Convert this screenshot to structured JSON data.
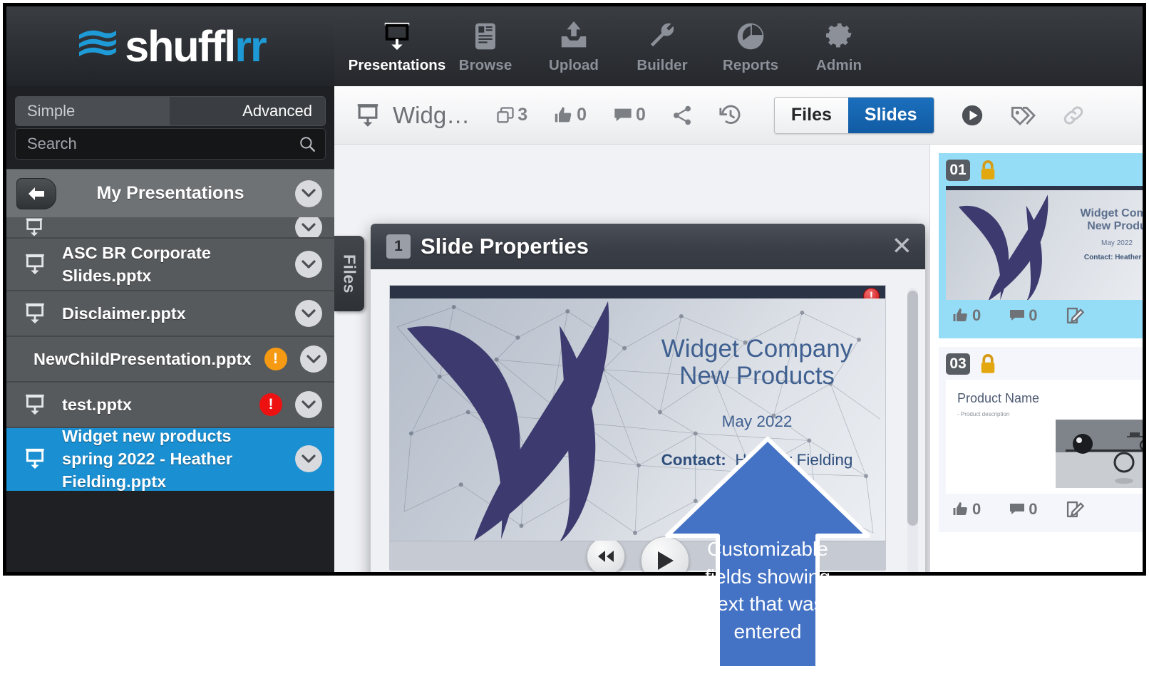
{
  "brand": {
    "name_white": "shuffl",
    "name_blue": "rr",
    "accent_blue": "#1e9ad6",
    "logo_icon": "stacked-slides-icon"
  },
  "topnav": {
    "items": [
      {
        "label": "Presentations",
        "icon": "presentation-screen-icon",
        "active": true
      },
      {
        "label": "Browse",
        "icon": "document-list-icon",
        "active": false
      },
      {
        "label": "Upload",
        "icon": "upload-tray-icon",
        "active": false
      },
      {
        "label": "Builder",
        "icon": "wrench-icon",
        "active": false
      },
      {
        "label": "Reports",
        "icon": "pie-chart-icon",
        "active": false
      },
      {
        "label": "Admin",
        "icon": "gear-icon",
        "active": false
      }
    ]
  },
  "sidebar": {
    "mode_simple": "Simple",
    "mode_advanced": "Advanced",
    "active_mode": "Advanced",
    "search_placeholder": "Search",
    "search_value": "",
    "search_icon": "magnifier-icon",
    "tree_header": "My Presentations",
    "back_icon": "back-arrow-icon",
    "chevron_icon": "chevron-down-icon",
    "items": [
      {
        "label": "ASC BR Corporate Slides.pptx",
        "icon": "presentation-screen-icon",
        "badge": null,
        "selected": false
      },
      {
        "label": "Disclaimer.pptx",
        "icon": "presentation-screen-icon",
        "badge": null,
        "selected": false
      },
      {
        "label": "NewChildPresentation.pptx",
        "icon": "presentation-screen-icon",
        "badge": "!",
        "badge_type": "warn",
        "badge_color": "#f59a12",
        "selected": false
      },
      {
        "label": "test.pptx",
        "icon": "presentation-screen-icon",
        "badge": "!",
        "badge_type": "error",
        "badge_color": "#ee1111",
        "selected": false
      },
      {
        "label": "Widget new products spring 2022 - Heather Fielding.pptx",
        "icon": "presentation-screen-icon",
        "badge": null,
        "selected": true
      }
    ],
    "selected_color": "#1a8fd1"
  },
  "toolbar": {
    "pres_icon": "presentation-screen-icon",
    "title": "Widg…",
    "copies_icon": "copy-slides-icon",
    "copies_count": "3",
    "like_icon": "thumbs-up-icon",
    "like_count": "0",
    "comment_icon": "comment-icon",
    "comment_count": "0",
    "share_icon": "share-icon",
    "history_icon": "history-clock-icon",
    "tab_files": "Files",
    "tab_slides": "Slides",
    "active_tab": "Slides",
    "active_tab_color": "#1b6fbd",
    "play_icon": "play-circle-icon",
    "tag_icon": "tag-icon",
    "link_icon": "link-icon"
  },
  "files_tab": {
    "label": "Files"
  },
  "modal": {
    "slide_number": "1",
    "title": "Slide Properties",
    "close_icon": "close-x-icon",
    "alert_badge": "!",
    "slide": {
      "title_line1": "Widget Company",
      "title_line2": "New Products",
      "date": "May 2022",
      "contact_label": "Contact:",
      "contact_value": "Heather Fielding",
      "text_color": "#3f6090",
      "rewind_icon": "rewind-icon",
      "play_icon": "play-icon"
    }
  },
  "thumbnails": [
    {
      "number": "01",
      "lock_icon": "lock-icon",
      "selected": true,
      "selected_color": "#95ddf7",
      "like_icon": "thumbs-up-icon",
      "like_count": "0",
      "comment_icon": "comment-icon",
      "comment_count": "0",
      "edit_icon": "edit-pencil-icon",
      "slide_title_line1": "Widget Comp",
      "slide_title_line2": "New Produ",
      "slide_date": "May 2022",
      "slide_contact": "Contact:  Heather Fi"
    },
    {
      "number": "03",
      "lock_icon": "lock-icon",
      "selected": false,
      "like_icon": "thumbs-up-icon",
      "like_count": "0",
      "comment_icon": "comment-icon",
      "comment_count": "0",
      "edit_icon": "edit-pencil-icon",
      "slide_title": "Product Name",
      "slide_desc": "- Product description"
    }
  ],
  "annotation": {
    "text_line1": "Customizable",
    "text_line2": "fields showing",
    "text_line3": "text that was",
    "text_line4": "entered",
    "color": "#4472C4",
    "shape": "up-arrow-callout"
  }
}
